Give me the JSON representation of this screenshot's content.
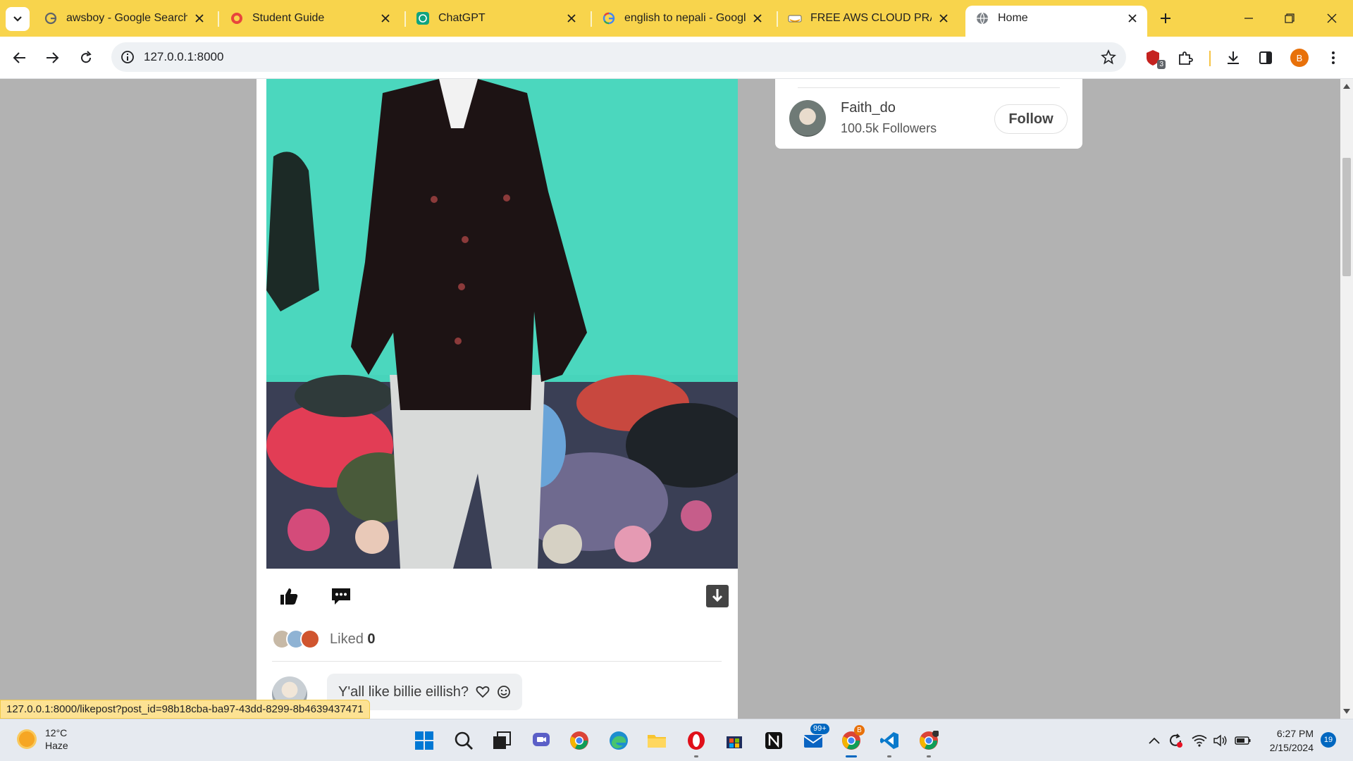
{
  "browser": {
    "tabs": [
      {
        "title": "awsboy - Google Search",
        "icon": "google-icon"
      },
      {
        "title": "Student Guide",
        "icon": "student-guide-icon"
      },
      {
        "title": "ChatGPT",
        "icon": "chatgpt-icon"
      },
      {
        "title": "english to nepali - Googl",
        "icon": "google-icon"
      },
      {
        "title": "FREE AWS CLOUD PRACT",
        "icon": "aws-course-icon"
      },
      {
        "title": "Home",
        "icon": "globe-icon",
        "active": true
      }
    ],
    "url": "127.0.0.1:8000",
    "extension_badge": "3",
    "profile_initial": "B",
    "accent_color": "#f8d44c"
  },
  "post": {
    "likes_label": "Liked",
    "likes_count": "0",
    "comment_text": "Y'all like billie eillish?"
  },
  "suggestion": {
    "name": "Faith_do",
    "followers": "100.5k Followers",
    "follow_label": "Follow"
  },
  "status_url": "127.0.0.1:8000/likepost?post_id=98b18cba-ba97-43dd-8299-8b4639437471",
  "taskbar": {
    "weather_temp": "12°C",
    "weather_desc": "Haze",
    "mail_badge": "99+",
    "chrome_badge": "B",
    "time": "6:27 PM",
    "date": "2/15/2024",
    "notification_count": "19"
  }
}
